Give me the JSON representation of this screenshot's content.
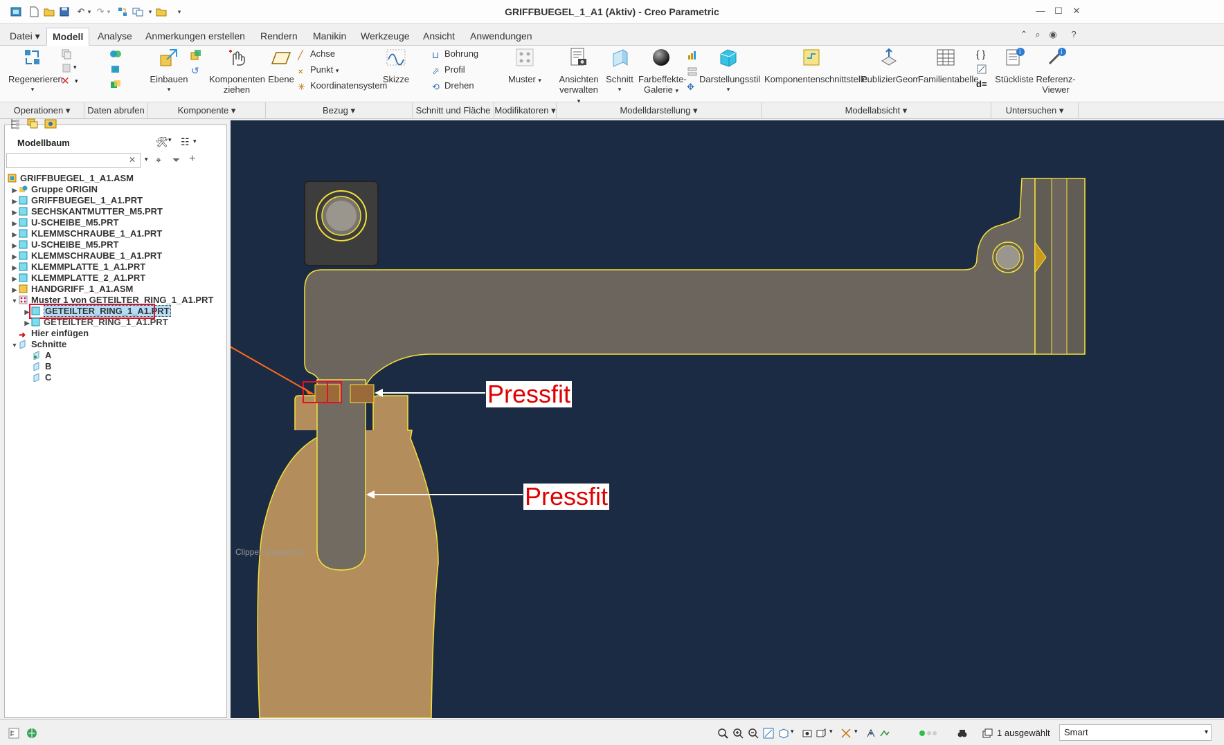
{
  "window": {
    "title": "GRIFFBUEGEL_1_A1 (Aktiv) - Creo Parametric"
  },
  "tabs": [
    {
      "label": "Datei"
    },
    {
      "label": "Modell"
    },
    {
      "label": "Analyse"
    },
    {
      "label": "Anmerkungen erstellen"
    },
    {
      "label": "Rendern"
    },
    {
      "label": "Manikin"
    },
    {
      "label": "Werkzeuge"
    },
    {
      "label": "Ansicht"
    },
    {
      "label": "Anwendungen"
    }
  ],
  "ribbon": {
    "regenerieren": "Regenerieren",
    "einbauen": "Einbauen",
    "komponenten_ziehen_1": "Komponenten",
    "komponenten_ziehen_2": "ziehen",
    "ebene": "Ebene",
    "achse": "Achse",
    "punkt": "Punkt",
    "koordinatensystem": "Koordinatensystem",
    "skizze": "Skizze",
    "bohrung": "Bohrung",
    "profil": "Profil",
    "drehen": "Drehen",
    "muster": "Muster",
    "ansichten_1": "Ansichten",
    "ansichten_2": "verwalten",
    "schnitt": "Schnitt",
    "farbeffekte_1": "Farbeffekte-",
    "farbeffekte_2": "Galerie",
    "darstellungsstil": "Darstellungsstil",
    "komponentenschnittstelle": "Komponentenschnittstelle",
    "publiziergeom": "PublizierGeom",
    "familientabelle": "Familientabelle",
    "stueckliste": "Stückliste",
    "referenz_1": "Referenz-",
    "referenz_2": "Viewer"
  },
  "groups": [
    {
      "label": "Operationen"
    },
    {
      "label": "Daten abrufen"
    },
    {
      "label": "Komponente"
    },
    {
      "label": "Bezug"
    },
    {
      "label": "Schnitt und Fläche"
    },
    {
      "label": "Modifikatoren"
    },
    {
      "label": "Modelldarstellung"
    },
    {
      "label": "Modellabsicht"
    },
    {
      "label": "Untersuchen"
    }
  ],
  "modelltree": {
    "title": "Modellbaum",
    "search_value": "",
    "items": [
      {
        "label": "GRIFFBUEGEL_1_A1.ASM"
      },
      {
        "label": "Gruppe ORIGIN"
      },
      {
        "label": "GRIFFBUEGEL_1_A1.PRT"
      },
      {
        "label": "SECHSKANTMUTTER_M5.PRT"
      },
      {
        "label": "U-SCHEIBE_M5.PRT"
      },
      {
        "label": "KLEMMSCHRAUBE_1_A1.PRT"
      },
      {
        "label": "U-SCHEIBE_M5.PRT"
      },
      {
        "label": "KLEMMSCHRAUBE_1_A1.PRT"
      },
      {
        "label": "KLEMMPLATTE_1_A1.PRT"
      },
      {
        "label": "KLEMMPLATTE_2_A1.PRT"
      },
      {
        "label": "HANDGRIFF_1_A1.ASM"
      },
      {
        "label": "Muster 1 von GETEILTER_RING_1_A1.PRT"
      },
      {
        "label": "GETEILTER_RING_1_A1.PRT"
      },
      {
        "label": "GETEILTER_RING_1_A1.PRT"
      },
      {
        "label": "Hier einfügen"
      },
      {
        "label": "Schnitte"
      },
      {
        "label": "A"
      },
      {
        "label": "B"
      },
      {
        "label": "C"
      }
    ]
  },
  "viewport": {
    "clip_label": "Clippen-Zustand:A",
    "annotation_1": "Pressfit",
    "annotation_2": "Pressfit"
  },
  "status": {
    "selected": "1 ausgewählt",
    "filter": "Smart"
  },
  "colors": {
    "viewport_bg": "#1c2b44",
    "part_gray": "#6b655d",
    "handle_tan": "#b38d5c",
    "outline_yellow": "#f5e13a",
    "annotation_red": "#e00000"
  }
}
